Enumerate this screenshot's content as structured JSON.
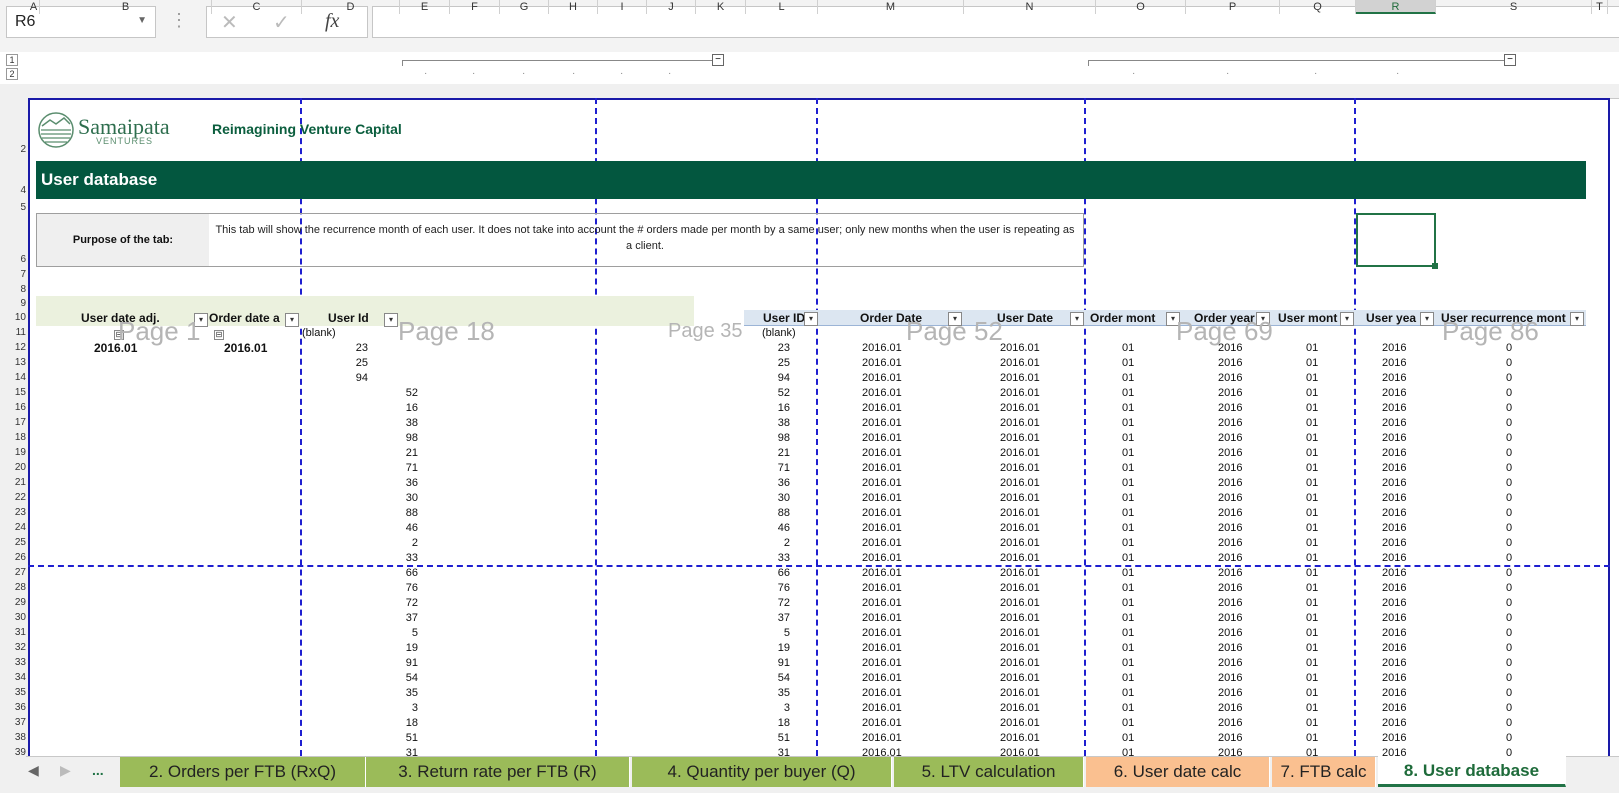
{
  "name_box": {
    "value": "R6"
  },
  "formula_bar": {
    "cancel": "✕",
    "enter": "✓",
    "fx": "fx",
    "content": ""
  },
  "outline_levels": [
    "1",
    "2"
  ],
  "columns": [
    "A",
    "B",
    "C",
    "D",
    "E",
    "F",
    "G",
    "H",
    "I",
    "J",
    "K",
    "L",
    "M",
    "N",
    "O",
    "P",
    "Q",
    "R",
    "S",
    "T"
  ],
  "rows": [
    "2",
    "4",
    "5",
    "6",
    "7",
    "8",
    "9",
    "10",
    "11",
    "12",
    "13",
    "14",
    "15",
    "16",
    "17",
    "18",
    "19",
    "20",
    "21",
    "22",
    "23",
    "24",
    "25",
    "26",
    "27",
    "28",
    "29",
    "30",
    "31",
    "32",
    "33",
    "34",
    "35",
    "36",
    "37",
    "38",
    "39"
  ],
  "logo": {
    "name": "Samaipata",
    "sub": "VENTURES"
  },
  "tagline": "Reimagining Venture Capital",
  "banner": "User database",
  "purpose": {
    "label": "Purpose of the tab:",
    "text": "This tab will show the recurrence month of each user. It does not take into account the # orders made per month by a same user; only new months when the user is repeating as a client."
  },
  "pivot": {
    "headers": [
      "User date adj.",
      "Order date a",
      "User Id"
    ],
    "blank": "(blank)",
    "group_label_1": "2016.01",
    "group_label_2": "2016.01"
  },
  "page_watermarks": [
    "Page 1",
    "Page 18",
    "Page 35",
    "Page 52",
    "Page 69",
    "Page 86"
  ],
  "table_headers": [
    "User ID",
    "Order Date",
    "User Date",
    "Order mont",
    "Order year",
    "User mont",
    "User yea",
    "User recurrence mont"
  ],
  "user_ids": [
    "23",
    "25",
    "94",
    "52",
    "16",
    "38",
    "98",
    "21",
    "71",
    "36",
    "30",
    "88",
    "46",
    "2",
    "33",
    "66",
    "76",
    "72",
    "37",
    "5",
    "19",
    "91",
    "54",
    "35",
    "3",
    "18",
    "51",
    "31"
  ],
  "table_row_values": {
    "order_date": "2016.01",
    "user_date": "2016.01",
    "order_month": "01",
    "order_year": "2016",
    "user_month": "01",
    "user_year": "2016",
    "recurrence": "0"
  },
  "sheet_tabs": [
    {
      "label": "2. Orders per FTB (RxQ)",
      "color": "#9bbb59",
      "active": false
    },
    {
      "label": "3. Return rate per FTB (R)",
      "color": "#9bbb59",
      "active": false
    },
    {
      "label": "4. Quantity per buyer (Q)",
      "color": "#9bbb59",
      "active": false
    },
    {
      "label": "5. LTV calculation",
      "color": "#9bbb59",
      "active": false
    },
    {
      "label": "6. User date calc",
      "color": "#fac090",
      "active": false
    },
    {
      "label": "7. FTB calc",
      "color": "#fac090",
      "active": false
    },
    {
      "label": "8. User database",
      "color": "#ffffff",
      "active": true
    }
  ],
  "tab_nav": {
    "prev": "◀",
    "next": "▶",
    "more": "..."
  }
}
